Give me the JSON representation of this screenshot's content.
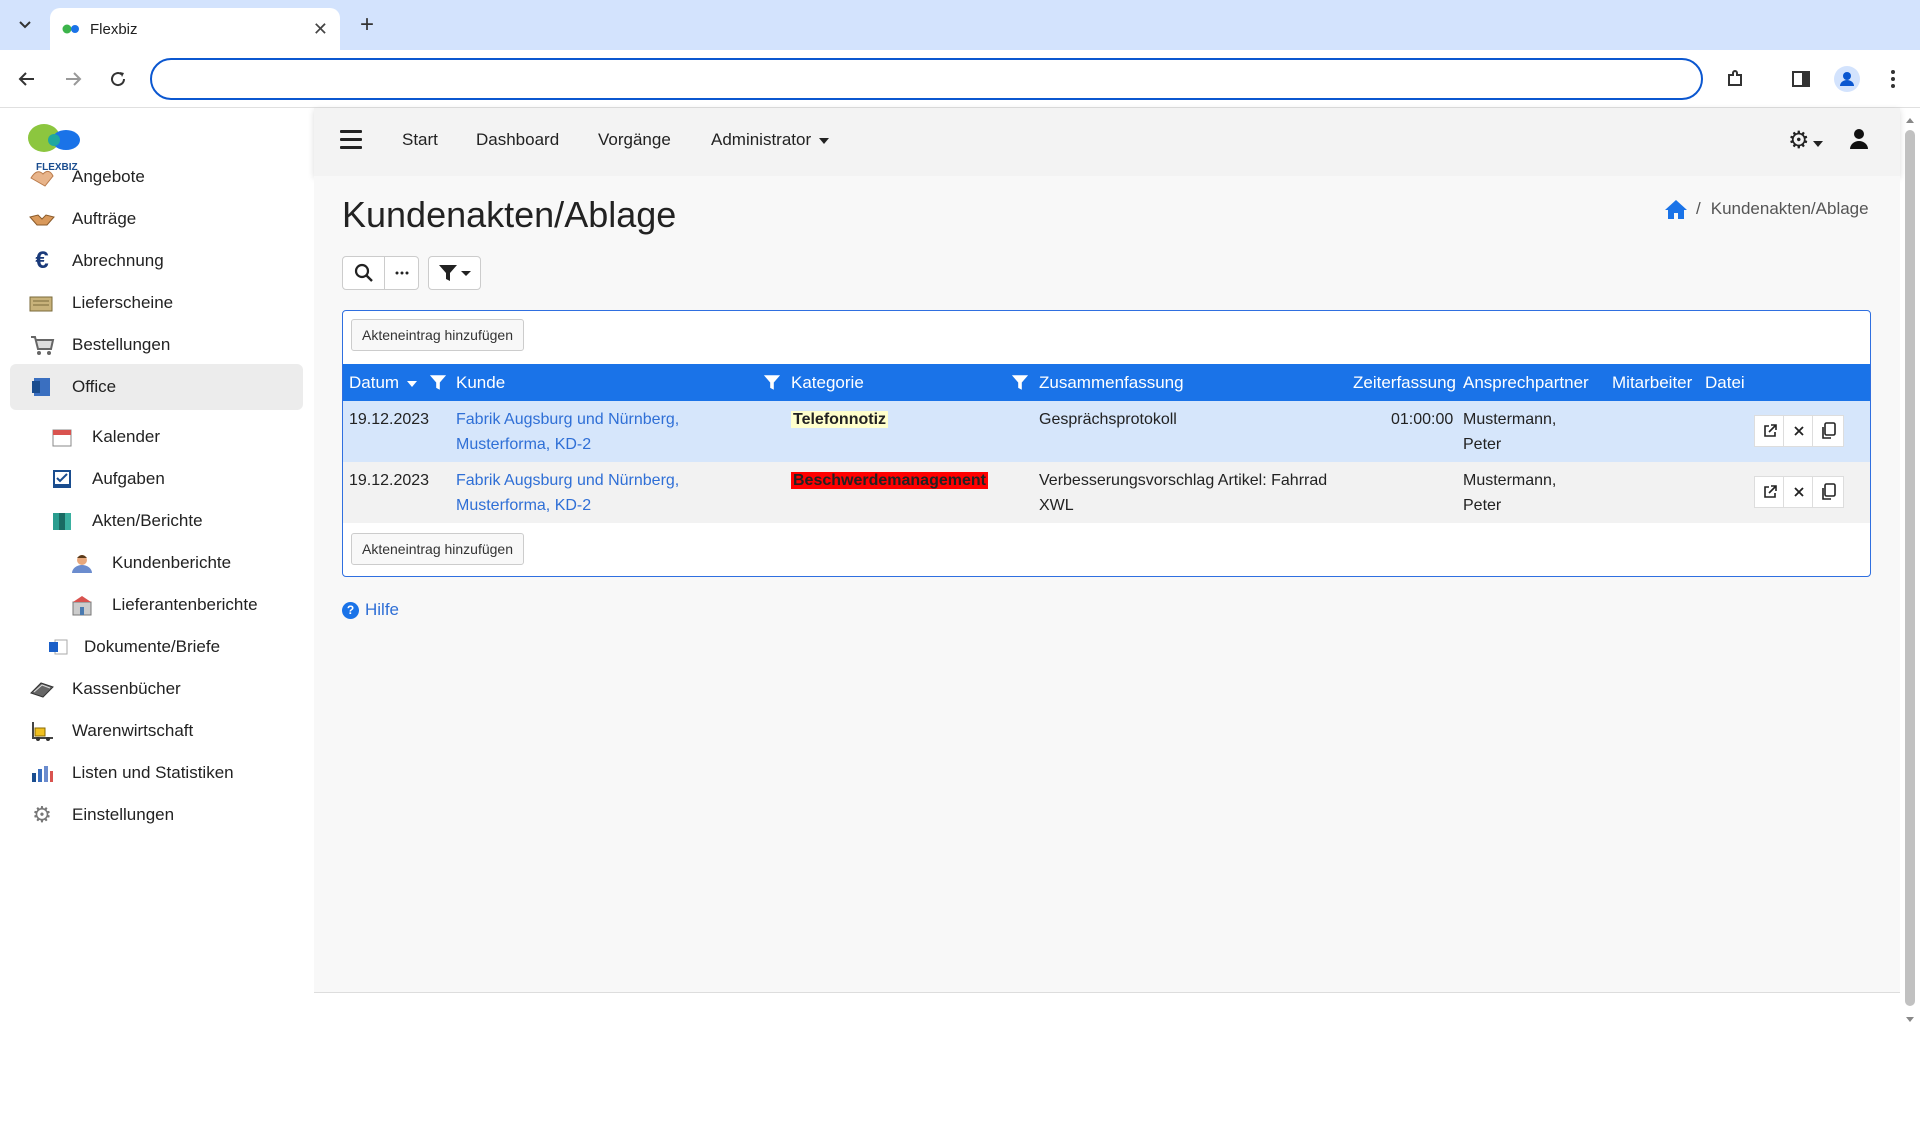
{
  "browser": {
    "tab_title": "Flexbiz",
    "address": ""
  },
  "sidebar": {
    "logo_text": "FLEXBIZ",
    "items": [
      {
        "label": "Angebote",
        "icon": "handshake-offer-icon"
      },
      {
        "label": "Aufträge",
        "icon": "handshake-icon"
      },
      {
        "label": "Abrechnung",
        "icon": "euro-icon"
      },
      {
        "label": "Lieferscheine",
        "icon": "delivery-note-icon"
      },
      {
        "label": "Bestellungen",
        "icon": "cart-icon"
      },
      {
        "label": "Office",
        "icon": "office-icon"
      },
      {
        "label": "Kalender",
        "icon": "calendar-icon"
      },
      {
        "label": "Aufgaben",
        "icon": "task-icon"
      },
      {
        "label": "Akten/Berichte",
        "icon": "binder-icon"
      },
      {
        "label": "Kundenberichte",
        "icon": "customer-icon"
      },
      {
        "label": "Lieferantenberichte",
        "icon": "supplier-icon"
      },
      {
        "label": "Dokumente/Briefe",
        "icon": "document-icon"
      },
      {
        "label": "Kassenbücher",
        "icon": "cashbook-icon"
      },
      {
        "label": "Warenwirtschaft",
        "icon": "forklift-icon"
      },
      {
        "label": "Listen und Statistiken",
        "icon": "chart-icon"
      },
      {
        "label": "Einstellungen",
        "icon": "gear-icon"
      }
    ]
  },
  "header": {
    "menu": [
      "Start",
      "Dashboard",
      "Vorgänge",
      "Administrator"
    ]
  },
  "page": {
    "title": "Kundenakten/Ablage",
    "breadcrumb": "Kundenakten/Ablage",
    "add_button": "Akteneintrag hinzufügen",
    "help": "Hilfe"
  },
  "table": {
    "columns": [
      "Datum",
      "Kunde",
      "Kategorie",
      "Zusammenfassung",
      "Zeiterfassung",
      "Ansprechpartner",
      "Mitarbeiter",
      "Datei"
    ],
    "rows": [
      {
        "datum": "19.12.2023",
        "kunde_1": "Fabrik Augsburg und Nürnberg,",
        "kunde_2": "Musterforma, KD-2",
        "kategorie": "Telefonnotiz",
        "zusammenfassung_1": "Gesprächsprotokoll",
        "zusammenfassung_2": "",
        "zeit": "01:00:00",
        "ansprech_1": "Mustermann,",
        "ansprech_2": "Peter"
      },
      {
        "datum": "19.12.2023",
        "kunde_1": "Fabrik Augsburg und Nürnberg,",
        "kunde_2": "Musterforma, KD-2",
        "kategorie": "Beschwerdemanagement",
        "zusammenfassung_1": "Verbesserungsvorschlag Artikel: Fahrrad",
        "zusammenfassung_2": "XWL",
        "zeit": "",
        "ansprech_1": "Mustermann,",
        "ansprech_2": "Peter"
      }
    ]
  },
  "colors": {
    "primary": "#1a73e8",
    "link": "#2f6fd6",
    "selected_row": "#d6e6fb",
    "badge_yellow": "#ffffcc",
    "badge_red": "#ff0000"
  }
}
